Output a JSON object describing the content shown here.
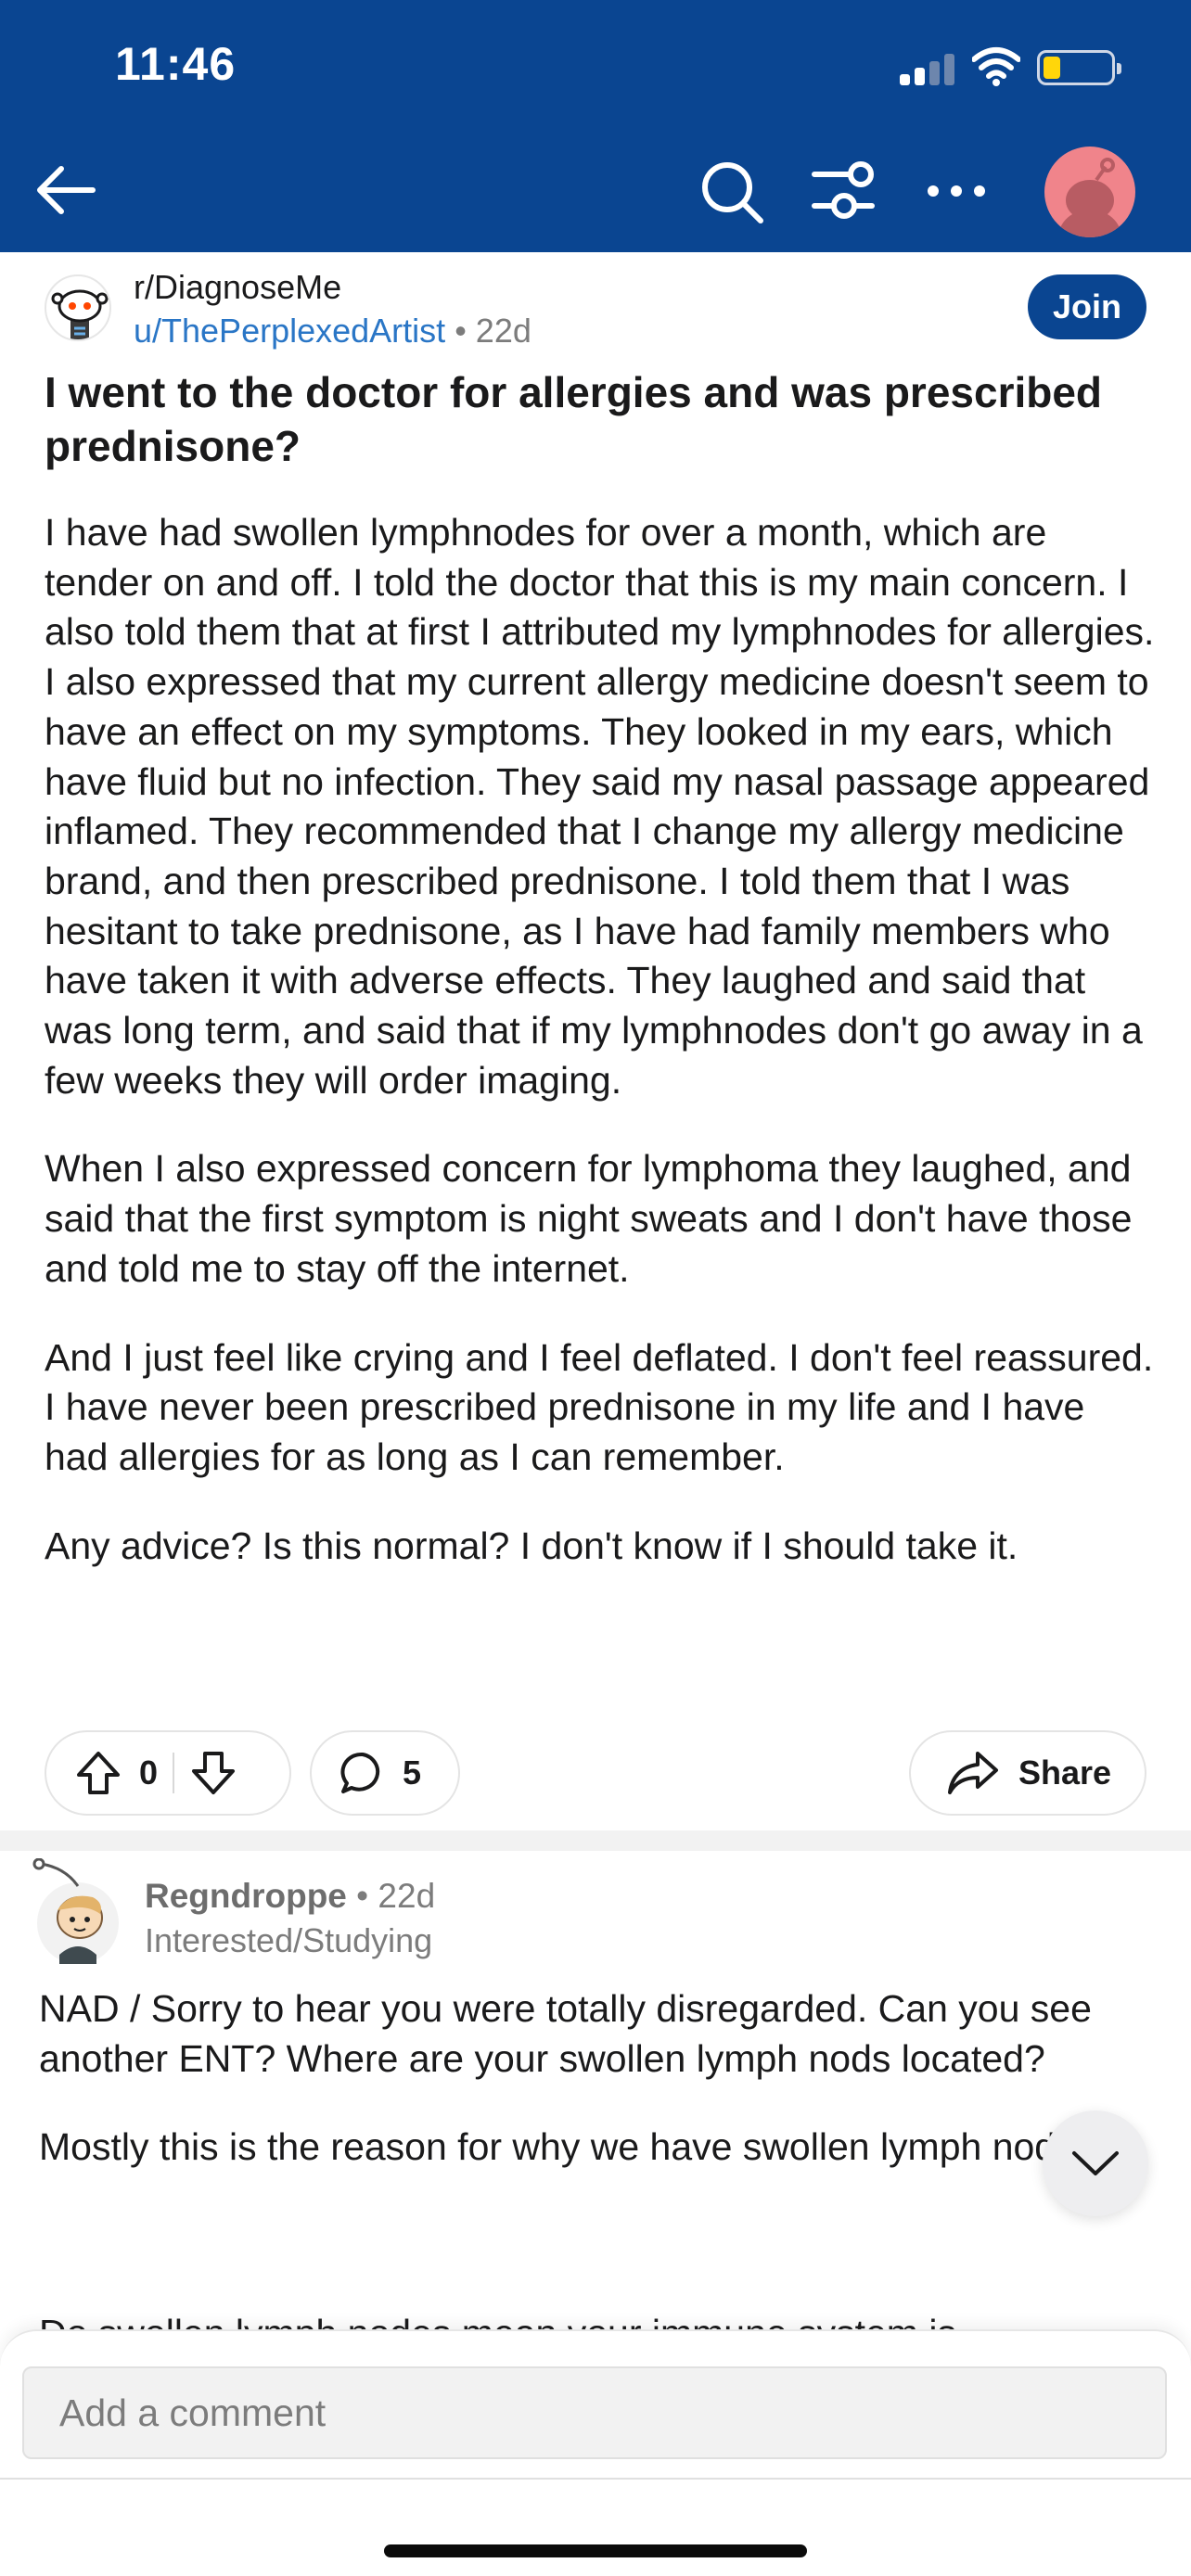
{
  "status_bar": {
    "time": "11:46"
  },
  "nav": {
    "back_icon": "arrow-left-icon",
    "search_icon": "search-icon",
    "filter_icon": "sort-filter-icon",
    "more_icon": "more-dots-icon",
    "avatar_icon": "user-avatar-icon"
  },
  "post": {
    "subreddit": "r/DiagnoseMe",
    "author": "u/ThePerplexedArtist",
    "age": "22d",
    "join_label": "Join",
    "title": "I went to the doctor for allergies and was prescribed prednisone?",
    "paragraphs": [
      "I have had swollen lymphnodes for over a month, which are tender on and off. I told the doctor that this is my main concern. I also told them that at first I attributed my lymphnodes for allergies. I also expressed that my current allergy medicine doesn't seem to have an effect on my symptoms. They looked in my ears, which have fluid but no infection. They said my nasal passage appeared inflamed. They recommended that I change my allergy medicine brand, and then prescribed prednisone. I told them that I was hesitant to take prednisone, as I have had family members who have taken it with adverse effects. They laughed and said that was long term, and said that if my lymphnodes don't go away in a few weeks they will order imaging.",
      "When I also expressed concern for lymphoma they laughed, and said that the first symptom is night sweats and I don't have those and told me to stay off the internet.",
      "And I just feel like crying and I feel deflated. I don't feel reassured. I have never been prescribed prednisone in my life and I have had allergies for as long as I can remember.",
      "Any advice? Is this normal? I don't know if I should take it."
    ],
    "votes": "0",
    "comments": "5",
    "share_label": "Share"
  },
  "comment": {
    "username": "Regndroppe",
    "separator": "•",
    "age": "22d",
    "flair": "Interested/Studying",
    "paragraphs": [
      "NAD /   Sorry to hear you were totally disregarded.  Can you see another ENT?  Where are your swollen lymph nods located?",
      "Mostly this is the reason for why we have swollen lymph nods ;",
      "Do swollen lymph nodes mean your immune system is"
    ]
  },
  "composer": {
    "placeholder": "Add a comment"
  },
  "colors": {
    "header_bg": "#0a4591",
    "link": "#2a76c6",
    "join_bg": "#0a4591"
  }
}
